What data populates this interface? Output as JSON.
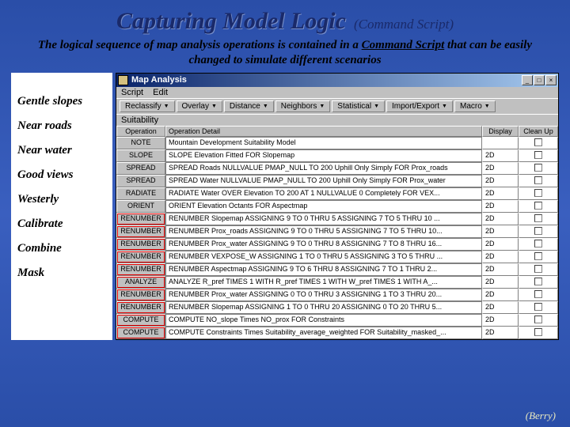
{
  "slide": {
    "title_main": "Capturing Model Logic",
    "title_sub": "(Command Script)",
    "desc_1": "The logical sequence of map analysis operations is contained in a ",
    "desc_u": "Command  Script",
    "desc_2": " that can be easily changed to simulate different scenarios",
    "credit": "(Berry)"
  },
  "labels": [
    "Gentle slopes",
    "Near roads",
    "Near water",
    "Good views",
    "Westerly",
    "Calibrate",
    "Combine",
    "Mask"
  ],
  "win": {
    "title": "Map Analysis",
    "sysbuttons": {
      "min": "_",
      "max": "□",
      "close": "×"
    },
    "menu": [
      "Script",
      "Edit"
    ],
    "toolbar": [
      "Reclassify",
      "Overlay",
      "Distance",
      "Neighbors",
      "Statistical",
      "Import/Export",
      "Macro"
    ],
    "panel_title": "Suitability",
    "headers": {
      "op": "Operation",
      "det": "Operation Detail",
      "disp": "Display",
      "cln": "Clean Up"
    }
  },
  "rows": [
    {
      "op": "NOTE",
      "det": "Mountain Development Suitability Model",
      "disp": "",
      "hl": false
    },
    {
      "op": "SLOPE",
      "det": "SLOPE Elevation Fitted FOR Slopemap",
      "disp": "2D",
      "hl": false
    },
    {
      "op": "SPREAD",
      "det": "SPREAD Roads NULLVALUE PMAP_NULL TO 200 Uphill Only Simply FOR Prox_roads",
      "disp": "2D",
      "hl": false
    },
    {
      "op": "SPREAD",
      "det": "SPREAD Water NULLVALUE PMAP_NULL TO 200 Uphill Only Simply FOR Prox_water",
      "disp": "2D",
      "hl": false
    },
    {
      "op": "RADIATE",
      "det": "RADIATE Water OVER Elevation TO 200 AT 1 NULLVALUE 0 Completely FOR VEX...",
      "disp": "2D",
      "hl": false
    },
    {
      "op": "ORIENT",
      "det": "ORIENT Elevation Octants FOR Aspectmap",
      "disp": "2D",
      "hl": false
    },
    {
      "op": "RENUMBER",
      "det": "RENUMBER Slopemap ASSIGNING 9 TO 0 THRU 5 ASSIGNING 7 TO 5 THRU 10 ...",
      "disp": "2D",
      "hl": true
    },
    {
      "op": "RENUMBER",
      "det": "RENUMBER Prox_roads ASSIGNING 9 TO 0 THRU 5 ASSIGNING 7 TO 5 THRU 10...",
      "disp": "2D",
      "hl": true
    },
    {
      "op": "RENUMBER",
      "det": "RENUMBER Prox_water ASSIGNING 9 TO 0 THRU 8 ASSIGNING 7 TO 8 THRU 16...",
      "disp": "2D",
      "hl": true
    },
    {
      "op": "RENUMBER",
      "det": "RENUMBER VEXPOSE_W ASSIGNING 1 TO 0 THRU 5 ASSIGNING 3 TO 5 THRU ...",
      "disp": "2D",
      "hl": true
    },
    {
      "op": "RENUMBER",
      "det": "RENUMBER Aspectmap ASSIGNING 9 TO 6 THRU 8 ASSIGNING 7 TO 1 THRU 2...",
      "disp": "2D",
      "hl": true
    },
    {
      "op": "ANALYZE",
      "det": "ANALYZE R_pref TIMES 1 WITH R_pref TIMES 1 WITH W_pref TIMES 1 WITH A_...",
      "disp": "2D",
      "hl": true
    },
    {
      "op": "RENUMBER",
      "det": "RENUMBER Prox_water ASSIGNING 0 TO 0 THRU 3 ASSIGNING 1 TO 3 THRU 20...",
      "disp": "2D",
      "hl": true
    },
    {
      "op": "RENUMBER",
      "det": "RENUMBER Slopemap ASSIGNING 1 TO 0 THRU 20 ASSIGNING 0 TO 20 THRU 5...",
      "disp": "2D",
      "hl": true
    },
    {
      "op": "COMPUTE",
      "det": "COMPUTE NO_slope Times NO_prox FOR Constraints",
      "disp": "2D",
      "hl": true
    },
    {
      "op": "COMPUTE",
      "det": "COMPUTE Constraints Times Suitability_average_weighted FOR Suitability_masked_...",
      "disp": "2D",
      "hl": true
    }
  ]
}
